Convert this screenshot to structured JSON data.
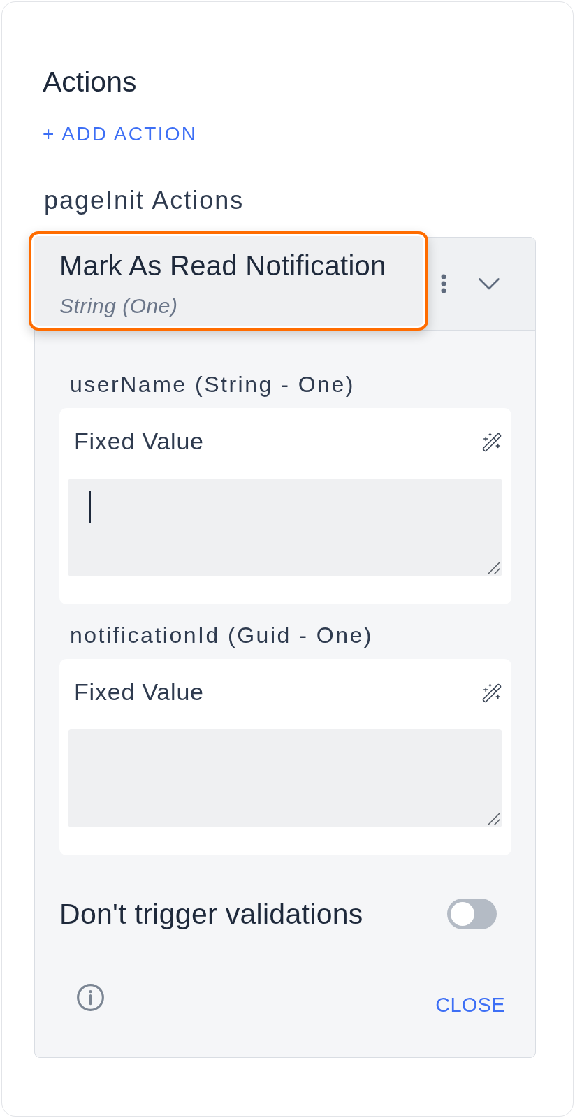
{
  "section": {
    "title": "Actions",
    "add_button": "+ ADD ACTION"
  },
  "group": {
    "title": "pageInit Actions"
  },
  "action": {
    "title": "Mark As Read Notification",
    "subtitle": "String (One)",
    "highlighted": true,
    "expanded": true,
    "parameters": [
      {
        "label": "userName (String - One)",
        "source": "Fixed Value",
        "focused": true
      },
      {
        "label": "notificationId (Guid - One)",
        "source": "Fixed Value",
        "focused": false
      }
    ],
    "toggle": {
      "label": "Don't trigger validations",
      "on": false
    },
    "close_button": "CLOSE"
  }
}
